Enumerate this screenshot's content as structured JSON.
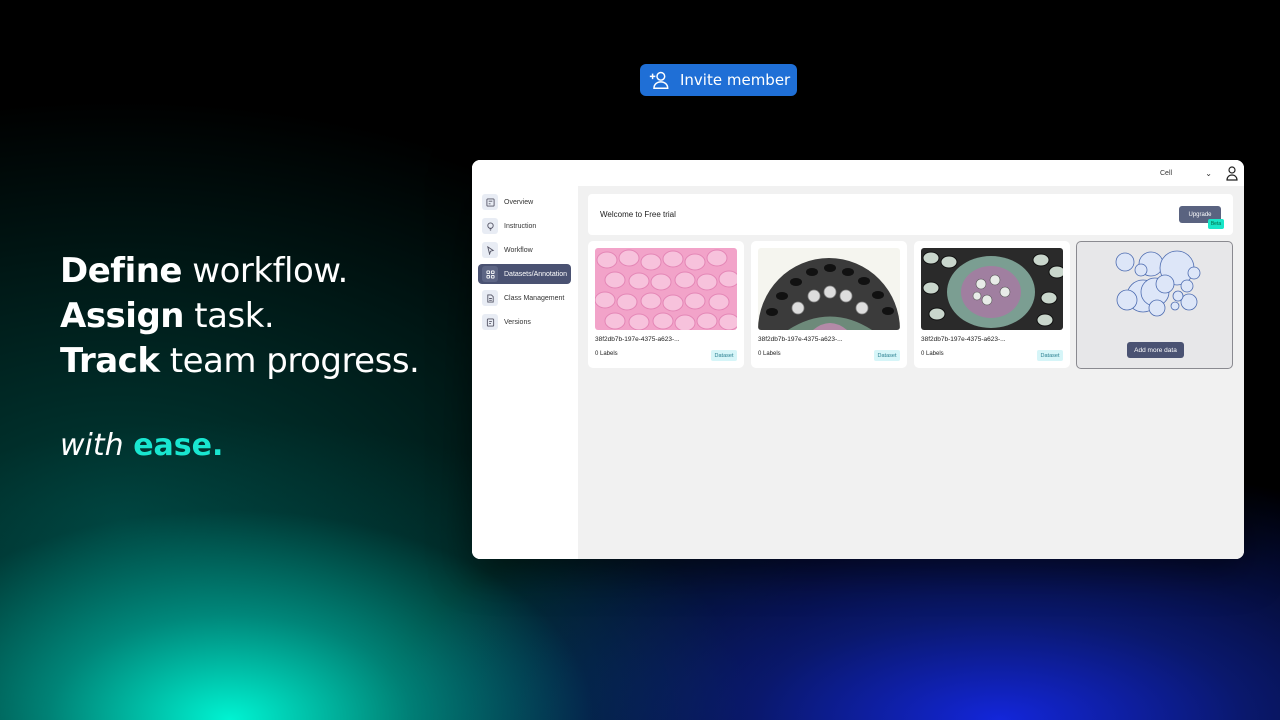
{
  "hero": {
    "line1_bold": "Define",
    "line1_rest": " workflow.",
    "line2_bold": "Assign",
    "line2_rest": " task.",
    "line3_bold": "Track",
    "line3_rest": " team progress.",
    "tagline_soft": "with ",
    "tagline_accent": "ease."
  },
  "invite": {
    "label": "Invite member",
    "icon": "add-user-icon"
  },
  "topbar": {
    "project": "Cell",
    "user_icon": "user-icon"
  },
  "sidebar": {
    "items": [
      {
        "label": "Overview",
        "icon": "overview-icon"
      },
      {
        "label": "Instruction",
        "icon": "lightbulb-icon"
      },
      {
        "label": "Workflow",
        "icon": "cursor-icon"
      },
      {
        "label": "Datasets/Annotation",
        "icon": "grid-icon",
        "active": true
      },
      {
        "label": "Class Management",
        "icon": "document-icon"
      },
      {
        "label": "Versions",
        "icon": "versions-icon"
      }
    ]
  },
  "banner": {
    "text": "Welcome to Free trial",
    "upgrade": "Upgrade",
    "beta": "Beta"
  },
  "datasets": [
    {
      "title": "38f2db7b-197e-4375-a623-...",
      "labels": "0 Labels",
      "badge": "Dataset"
    },
    {
      "title": "38f2db7b-197e-4375-a623-...",
      "labels": "0 Labels",
      "badge": "Dataset"
    },
    {
      "title": "38f2db7b-197e-4375-a623-...",
      "labels": "0 Labels",
      "badge": "Dataset"
    }
  ],
  "add_card": {
    "button": "Add more data"
  },
  "colors": {
    "accent": "#19e6d0",
    "invite": "#1f6fd6",
    "sidebar_active": "#4a5272"
  }
}
